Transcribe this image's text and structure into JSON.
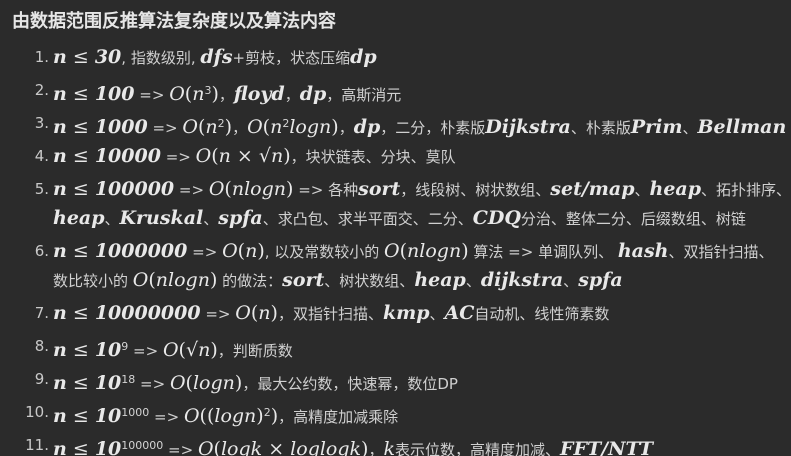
{
  "heading": "由数据范围反推算法复杂度以及算法内容",
  "items": [
    {
      "number": "1.",
      "segments": [
        {
          "k": "mb",
          "v": "n"
        },
        {
          "k": "mn",
          "v": " ≤ "
        },
        {
          "k": "mb",
          "v": "30"
        },
        {
          "k": "t",
          "v": ", 指数级别, "
        },
        {
          "k": "mb",
          "v": "dfs"
        },
        {
          "k": "t",
          "v": "+剪枝，状态压缩"
        },
        {
          "k": "mb",
          "v": "dp"
        }
      ]
    },
    {
      "number": "2.",
      "segments": [
        {
          "k": "mb",
          "v": "n"
        },
        {
          "k": "mn",
          "v": " ≤ "
        },
        {
          "k": "mb",
          "v": "100"
        },
        {
          "k": "op",
          "v": " => "
        },
        {
          "k": "m",
          "v": "O"
        },
        {
          "k": "mn",
          "v": "("
        },
        {
          "k": "m",
          "v": "n"
        },
        {
          "k": "sup",
          "v": "3"
        },
        {
          "k": "mn",
          "v": ")"
        },
        {
          "k": "t",
          "v": "，"
        },
        {
          "k": "mb",
          "v": "floyd"
        },
        {
          "k": "t",
          "v": "，"
        },
        {
          "k": "mb",
          "v": "dp"
        },
        {
          "k": "t",
          "v": "，高斯消元"
        }
      ]
    },
    {
      "number": "3.",
      "segments": [
        {
          "k": "mb",
          "v": "n"
        },
        {
          "k": "mn",
          "v": " ≤ "
        },
        {
          "k": "mb",
          "v": "1000"
        },
        {
          "k": "op",
          "v": " => "
        },
        {
          "k": "m",
          "v": "O"
        },
        {
          "k": "mn",
          "v": "("
        },
        {
          "k": "m",
          "v": "n"
        },
        {
          "k": "sup",
          "v": "2"
        },
        {
          "k": "mn",
          "v": ")"
        },
        {
          "k": "t",
          "v": "，"
        },
        {
          "k": "m",
          "v": "O"
        },
        {
          "k": "mn",
          "v": "("
        },
        {
          "k": "m",
          "v": "n"
        },
        {
          "k": "sup",
          "v": "2"
        },
        {
          "k": "m",
          "v": "logn"
        },
        {
          "k": "mn",
          "v": ")"
        },
        {
          "k": "t",
          "v": "，"
        },
        {
          "k": "mb",
          "v": "dp"
        },
        {
          "k": "t",
          "v": "，二分，朴素版"
        },
        {
          "k": "mb",
          "v": "Dijkstra"
        },
        {
          "k": "t",
          "v": "、朴素版"
        },
        {
          "k": "mb",
          "v": "Prim"
        },
        {
          "k": "t",
          "v": "、"
        },
        {
          "k": "mb",
          "v": "Bellman"
        }
      ]
    },
    {
      "number": "4.",
      "segments": [
        {
          "k": "mb",
          "v": "n"
        },
        {
          "k": "mn",
          "v": " ≤ "
        },
        {
          "k": "mb",
          "v": "10000"
        },
        {
          "k": "op",
          "v": " => "
        },
        {
          "k": "m",
          "v": "O"
        },
        {
          "k": "mn",
          "v": "("
        },
        {
          "k": "m",
          "v": "n"
        },
        {
          "k": "mn",
          "v": " × √"
        },
        {
          "k": "m",
          "v": "n"
        },
        {
          "k": "mn",
          "v": ")"
        },
        {
          "k": "t",
          "v": "，块状链表、分块、莫队"
        }
      ]
    },
    {
      "number": "5.",
      "segments": [
        {
          "k": "mb",
          "v": "n"
        },
        {
          "k": "mn",
          "v": " ≤ "
        },
        {
          "k": "mb",
          "v": "100000"
        },
        {
          "k": "op",
          "v": " => "
        },
        {
          "k": "m",
          "v": "O"
        },
        {
          "k": "mn",
          "v": "("
        },
        {
          "k": "m",
          "v": "nlogn"
        },
        {
          "k": "mn",
          "v": ")"
        },
        {
          "k": "op",
          "v": " => "
        },
        {
          "k": "t",
          "v": "各种"
        },
        {
          "k": "mb",
          "v": "sort"
        },
        {
          "k": "t",
          "v": "，线段树、树状数组、"
        },
        {
          "k": "mb",
          "v": "set/map"
        },
        {
          "k": "t",
          "v": "、"
        },
        {
          "k": "mb",
          "v": "heap"
        },
        {
          "k": "t",
          "v": "、拓扑排序、"
        }
      ],
      "segments2": [
        {
          "k": "mb",
          "v": "heap"
        },
        {
          "k": "t",
          "v": "、"
        },
        {
          "k": "mb",
          "v": "Kruskal"
        },
        {
          "k": "t",
          "v": "、"
        },
        {
          "k": "mb",
          "v": "spfa"
        },
        {
          "k": "t",
          "v": "、求凸包、求半平面交、二分、"
        },
        {
          "k": "mb",
          "v": "CDQ"
        },
        {
          "k": "t",
          "v": "分治、整体二分、后缀数组、树链"
        }
      ]
    },
    {
      "number": "6.",
      "segments": [
        {
          "k": "mb",
          "v": "n"
        },
        {
          "k": "mn",
          "v": " ≤ "
        },
        {
          "k": "mb",
          "v": "1000000"
        },
        {
          "k": "op",
          "v": " => "
        },
        {
          "k": "m",
          "v": "O"
        },
        {
          "k": "mn",
          "v": "("
        },
        {
          "k": "m",
          "v": "n"
        },
        {
          "k": "mn",
          "v": ")"
        },
        {
          "k": "t",
          "v": ", 以及常数较小的 "
        },
        {
          "k": "m",
          "v": "O"
        },
        {
          "k": "mn",
          "v": "("
        },
        {
          "k": "m",
          "v": "nlogn"
        },
        {
          "k": "mn",
          "v": ")"
        },
        {
          "k": "t",
          "v": " 算法 "
        },
        {
          "k": "op",
          "v": "=> "
        },
        {
          "k": "t",
          "v": "单调队列、 "
        },
        {
          "k": "mb",
          "v": "hash"
        },
        {
          "k": "t",
          "v": "、双指针扫描、"
        }
      ],
      "segments2": [
        {
          "k": "t",
          "v": "数比较小的 "
        },
        {
          "k": "m",
          "v": "O"
        },
        {
          "k": "mn",
          "v": "("
        },
        {
          "k": "m",
          "v": "nlogn"
        },
        {
          "k": "mn",
          "v": ")"
        },
        {
          "k": "t",
          "v": " 的做法："
        },
        {
          "k": "mb",
          "v": "sort"
        },
        {
          "k": "t",
          "v": "、树状数组、"
        },
        {
          "k": "mb",
          "v": "heap"
        },
        {
          "k": "t",
          "v": "、"
        },
        {
          "k": "mb",
          "v": "dijkstra"
        },
        {
          "k": "t",
          "v": "、"
        },
        {
          "k": "mb",
          "v": "spfa"
        }
      ]
    },
    {
      "number": "7.",
      "segments": [
        {
          "k": "mb",
          "v": "n"
        },
        {
          "k": "mn",
          "v": " ≤ "
        },
        {
          "k": "mb",
          "v": "10000000"
        },
        {
          "k": "op",
          "v": " => "
        },
        {
          "k": "m",
          "v": "O"
        },
        {
          "k": "mn",
          "v": "("
        },
        {
          "k": "m",
          "v": "n"
        },
        {
          "k": "mn",
          "v": ")"
        },
        {
          "k": "t",
          "v": "，双指针扫描、"
        },
        {
          "k": "mb",
          "v": "kmp"
        },
        {
          "k": "t",
          "v": "、"
        },
        {
          "k": "mb",
          "v": "AC"
        },
        {
          "k": "t",
          "v": "自动机、线性筛素数"
        }
      ]
    },
    {
      "number": "8.",
      "segments": [
        {
          "k": "mb",
          "v": "n"
        },
        {
          "k": "mn",
          "v": " ≤ "
        },
        {
          "k": "mb",
          "v": "10"
        },
        {
          "k": "sup",
          "v": "9"
        },
        {
          "k": "op",
          "v": " => "
        },
        {
          "k": "m",
          "v": "O"
        },
        {
          "k": "mn",
          "v": "(√"
        },
        {
          "k": "m",
          "v": "n"
        },
        {
          "k": "mn",
          "v": ")"
        },
        {
          "k": "t",
          "v": "，判断质数"
        }
      ]
    },
    {
      "number": "9.",
      "segments": [
        {
          "k": "mb",
          "v": "n"
        },
        {
          "k": "mn",
          "v": " ≤ "
        },
        {
          "k": "mb",
          "v": "10"
        },
        {
          "k": "sup",
          "v": "18"
        },
        {
          "k": "op",
          "v": " => "
        },
        {
          "k": "m",
          "v": "O"
        },
        {
          "k": "mn",
          "v": "("
        },
        {
          "k": "m",
          "v": "logn"
        },
        {
          "k": "mn",
          "v": ")"
        },
        {
          "k": "t",
          "v": "，最大公约数，快速幂，数位DP"
        }
      ]
    },
    {
      "number": "10.",
      "segments": [
        {
          "k": "mb",
          "v": "n"
        },
        {
          "k": "mn",
          "v": " ≤ "
        },
        {
          "k": "mb",
          "v": "10"
        },
        {
          "k": "sup",
          "v": "1000"
        },
        {
          "k": "op",
          "v": " => "
        },
        {
          "k": "m",
          "v": "O"
        },
        {
          "k": "mn",
          "v": "(("
        },
        {
          "k": "m",
          "v": "logn"
        },
        {
          "k": "mn",
          "v": ")"
        },
        {
          "k": "sup",
          "v": "2"
        },
        {
          "k": "mn",
          "v": ")"
        },
        {
          "k": "t",
          "v": "，高精度加减乘除"
        }
      ]
    },
    {
      "number": "11.",
      "segments": [
        {
          "k": "mb",
          "v": "n"
        },
        {
          "k": "mn",
          "v": " ≤ "
        },
        {
          "k": "mb",
          "v": "10"
        },
        {
          "k": "sup",
          "v": "100000"
        },
        {
          "k": "op",
          "v": " => "
        },
        {
          "k": "m",
          "v": "O"
        },
        {
          "k": "mn",
          "v": "("
        },
        {
          "k": "m",
          "v": "logk"
        },
        {
          "k": "mn",
          "v": " × "
        },
        {
          "k": "m",
          "v": "loglogk"
        },
        {
          "k": "mn",
          "v": ")"
        },
        {
          "k": "t",
          "v": "，"
        },
        {
          "k": "m",
          "v": "k"
        },
        {
          "k": "t",
          "v": "表示位数，高精度加减、"
        },
        {
          "k": "mb",
          "v": "FFT/NTT"
        }
      ]
    }
  ]
}
